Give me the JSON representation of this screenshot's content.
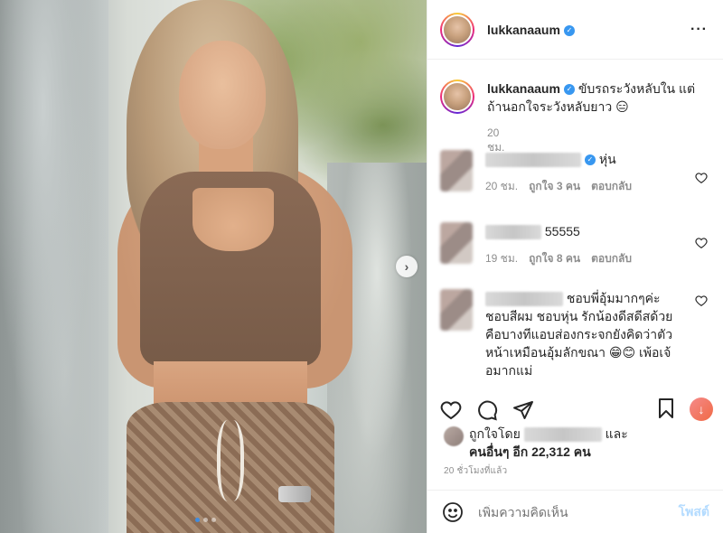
{
  "post": {
    "username": "lukkanaaum",
    "verified": true,
    "caption": "ขับรถระวังหลับใน แต่ถ้านอกใจระวังหลับยาว 😑",
    "caption_time": "20 ชม.",
    "more_icon": "more-horizontal-icon"
  },
  "comments": [
    {
      "text": "หุ่น",
      "time": "20 ชม.",
      "likes": "ถูกใจ 3 คน",
      "reply": "ตอบกลับ",
      "verified": true
    },
    {
      "text": "55555",
      "time": "19 ชม.",
      "likes": "ถูกใจ 8 คน",
      "reply": "ตอบกลับ"
    },
    {
      "text": "ชอบพี่อุ้มมากๆค่ะ ชอบสีผม ชอบหุ่น รักน้องดีสดีสด้วย คือบางทีแอบส่องกระจกยังคิดว่าตัวหน้าเหมือนอุ้มลักขณา 😁😊 เพ้อเจ้อมากแม่"
    }
  ],
  "actions": {
    "like_icon": "heart-icon",
    "comment_icon": "comment-icon",
    "share_icon": "send-icon",
    "save_icon": "bookmark-icon",
    "download_icon": "download-icon"
  },
  "likes": {
    "prefix": "ถูกใจโดย",
    "suffix": "และ",
    "others": "คนอื่นๆ อีก 22,312 คน"
  },
  "post_time": "20 ชั่วโมงที่แล้ว",
  "add_comment": {
    "placeholder": "เพิ่มความคิดเห็น",
    "post_label": "โพสต์"
  },
  "carousel": {
    "current": 1,
    "total": 3,
    "next_icon": "chevron-right-icon"
  },
  "colors": {
    "accent": "#3897f0",
    "muted": "#8e8e8e",
    "post_disabled": "#b3dbff"
  }
}
